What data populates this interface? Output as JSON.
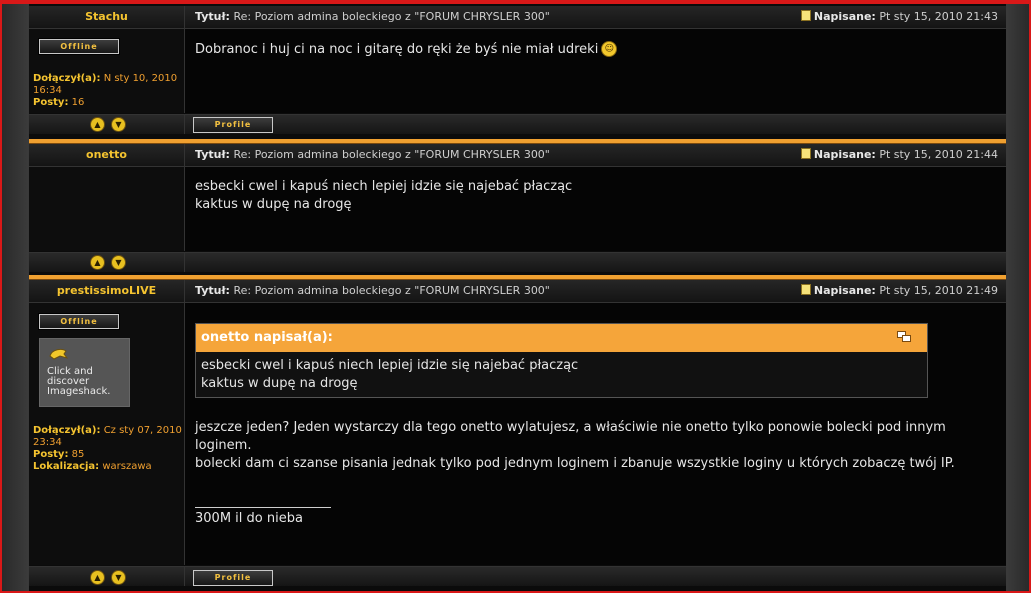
{
  "posts": [
    {
      "author": "Stachu",
      "status_badge": "Offline",
      "joined_label": "Dołączył(a):",
      "joined_value": "N sty 10, 2010 16:34",
      "posts_label": "Posty:",
      "posts_value": "16",
      "title_label": "Tytuł:",
      "title": "Re: Poziom admina boleckiego z \"FORUM CHRYSLER 300\"",
      "posted_label": "Napisane:",
      "posted_value": "Pt sty 15, 2010 21:43",
      "message": "Dobranoc i huj ci na noc i gitarę do ręki że byś nie miał udreki",
      "profile_label": "Profile"
    },
    {
      "author": "onetto",
      "title_label": "Tytuł:",
      "title": "Re: Poziom admina boleckiego z \"FORUM CHRYSLER 300\"",
      "posted_label": "Napisane:",
      "posted_value": "Pt sty 15, 2010 21:44",
      "message_line1": "esbecki cwel i kapuś niech lepiej idzie się najebać płacząc",
      "message_line2": "kaktus w dupę na drogę"
    },
    {
      "author": "prestissimoLIVE",
      "status_badge": "Offline",
      "avatar_text": "Click and discover Imageshack.",
      "joined_label": "Dołączył(a):",
      "joined_value": "Cz sty 07, 2010 23:34",
      "posts_label": "Posty:",
      "posts_value": "85",
      "location_label": "Lokalizacja:",
      "location_value": "warszawa",
      "title_label": "Tytuł:",
      "title": "Re: Poziom admina boleckiego z \"FORUM CHRYSLER 300\"",
      "posted_label": "Napisane:",
      "posted_value": "Pt sty 15, 2010 21:49",
      "quote_author": "onetto napisał(a):",
      "quote_line1": "esbecki cwel i kapuś niech lepiej idzie się najebać płacząc",
      "quote_line2": "kaktus w dupę na drogę",
      "message_line1": "jeszcze jeden? Jeden wystarczy dla tego onetto wylatujesz, a właściwie nie onetto tylko ponowie bolecki pod innym loginem.",
      "message_line2": "bolecki dam ci szanse pisania jednak tylko pod jednym loginem i zbanuje wszystkie loginy u których zobaczę twój IP.",
      "signature": "300M il do nieba",
      "profile_label": "Profile"
    }
  ],
  "colors": {
    "accent_orange": "#f0a030",
    "author_yellow": "#f5c430",
    "frame_red": "#d91818"
  }
}
